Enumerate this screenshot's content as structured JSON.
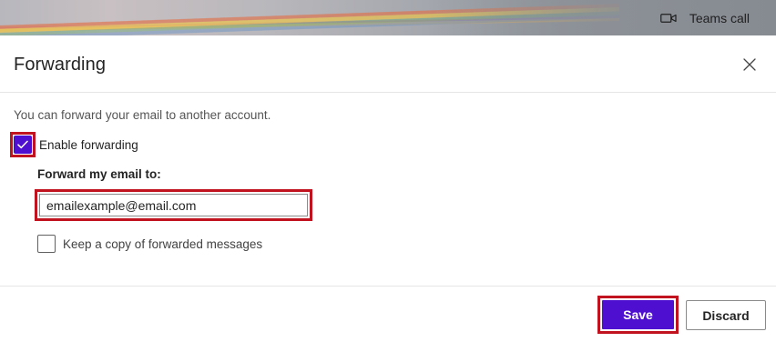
{
  "topbar": {
    "teams_call_label": "Teams call",
    "teams_call_icon": "video-camera-icon"
  },
  "dialog": {
    "title": "Forwarding",
    "close_icon": "close-icon",
    "intro_text": "You can forward your email to another account.",
    "enable_forwarding": {
      "label": "Enable forwarding",
      "checked": true
    },
    "forward_to_label": "Forward my email to:",
    "email_value": "emailexample@email.com",
    "keep_copy": {
      "label": "Keep a copy of forwarded messages",
      "checked": false
    }
  },
  "footer": {
    "save_label": "Save",
    "discard_label": "Discard"
  },
  "colors": {
    "accent": "#4f0fd0",
    "highlight": "#c1121f"
  }
}
